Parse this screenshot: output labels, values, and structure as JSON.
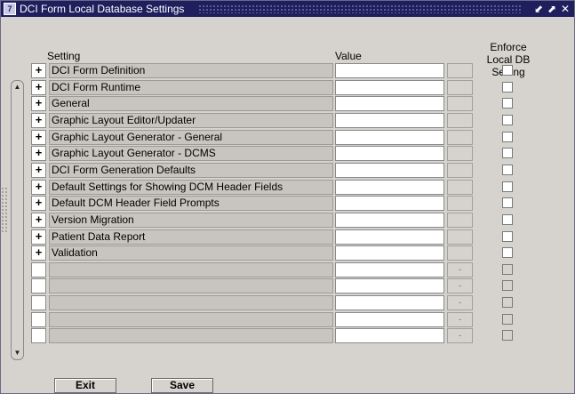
{
  "window": {
    "title": "DCI Form Local Database Settings",
    "app_icon_glyph": "7",
    "controls": [
      "⬋",
      "⬈",
      "✕"
    ]
  },
  "headers": {
    "setting": "Setting",
    "value": "Value",
    "enforce": [
      "Enforce",
      "Local DB",
      "Setting"
    ]
  },
  "rows": [
    {
      "expander": "+",
      "label": "DCI Form Definition"
    },
    {
      "expander": "+",
      "label": "DCI Form Runtime"
    },
    {
      "expander": "+",
      "label": "General"
    },
    {
      "expander": "+",
      "label": "Graphic Layout Editor/Updater"
    },
    {
      "expander": "+",
      "label": "Graphic Layout Generator - General"
    },
    {
      "expander": "+",
      "label": "Graphic Layout Generator - DCMS"
    },
    {
      "expander": "+",
      "label": "DCI Form Generation Defaults"
    },
    {
      "expander": "+",
      "label": "Default Settings for Showing DCM Header Fields"
    },
    {
      "expander": "+",
      "label": "Default DCM Header Field Prompts"
    },
    {
      "expander": "+",
      "label": "Version Migration"
    },
    {
      "expander": "+",
      "label": "Patient Data Report"
    },
    {
      "expander": "+",
      "label": "Validation"
    },
    {
      "expander": "",
      "label": "",
      "lov": "-"
    },
    {
      "expander": "",
      "label": "",
      "lov": "-"
    },
    {
      "expander": "",
      "label": "",
      "lov": "-"
    },
    {
      "expander": "",
      "label": "",
      "lov": "-"
    },
    {
      "expander": "",
      "label": "",
      "lov": "-"
    }
  ],
  "buttons": {
    "exit": "Exit",
    "save": "Save"
  },
  "scroll": {
    "up": "▲",
    "down": "▼"
  }
}
